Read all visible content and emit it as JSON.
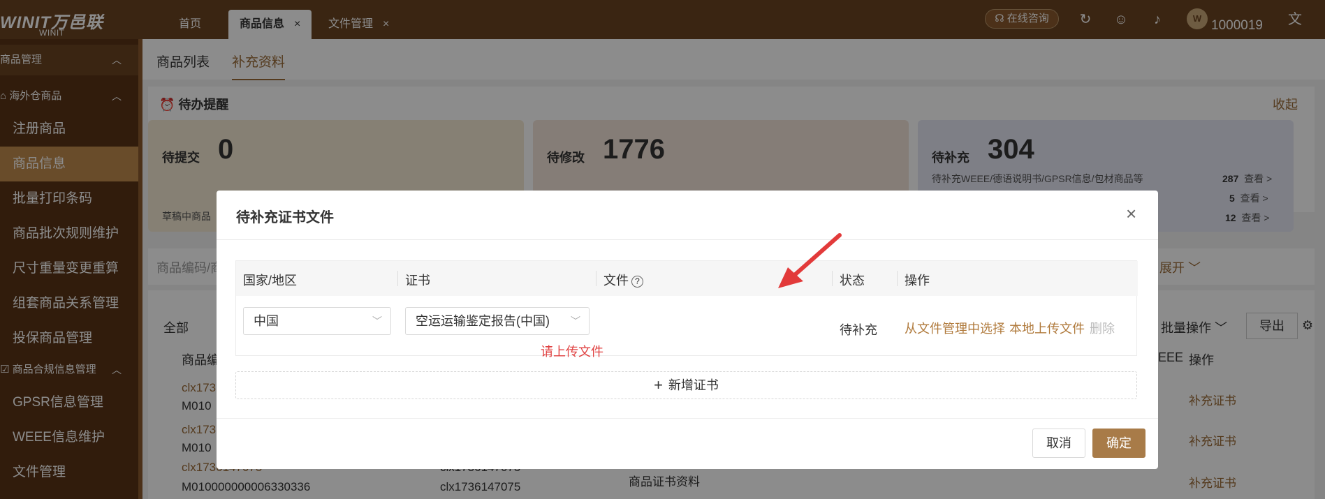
{
  "header": {
    "logo_brand": "WINIT万邑联",
    "logo_corp": "WINIT CORPORATION",
    "tabs": [
      {
        "label": "首页"
      },
      {
        "label": "商品信息"
      },
      {
        "label": "文件管理"
      }
    ],
    "close_glyph": "×",
    "consult_label": "在线咨询",
    "user_id": "1000019",
    "avatar_text": "W",
    "icons": [
      "refresh-icon",
      "service-icon",
      "bell-icon",
      "translate-icon"
    ]
  },
  "sidebar": {
    "group_label": "商品管理",
    "sub1_label": "海外仓商品",
    "items1": [
      "注册商品",
      "商品信息",
      "批量打印条码",
      "商品批次规则维护",
      "尺寸重量变更重算",
      "组套商品关系管理",
      "投保商品管理"
    ],
    "sub2_label": "商品合规信息管理",
    "items2": [
      "GPSR信息管理",
      "WEEE信息维护",
      "文件管理"
    ]
  },
  "content": {
    "subtabs": [
      "商品列表",
      "补充资料"
    ],
    "todo_title": "待办提醒",
    "collapse": "收起",
    "cards": [
      {
        "label": "待提交",
        "value": "0",
        "note": "草稿中商品"
      },
      {
        "label": "待修改",
        "value": "1776"
      },
      {
        "label": "待补充",
        "value": "304",
        "note": "待补充WEEE/德语说明书/GPSR信息/包材商品等"
      }
    ],
    "pending_rows": [
      {
        "count": "287",
        "link": "查看 >"
      },
      {
        "count": "5",
        "link": "查看 >"
      },
      {
        "count": "12",
        "link": "查看 >"
      }
    ],
    "search_placeholder": "商品编码/商",
    "expand": "展开",
    "all_tab": "全部",
    "batch_op": "批量操作",
    "export": "导出",
    "col_product": "商品编",
    "col_op": "操作",
    "col_weee": "EEE",
    "rows": [
      {
        "code1": "clx173",
        "code2": "M010",
        "action": "补充证书"
      },
      {
        "code1": "clx173",
        "code2": "M010",
        "action": "补充证书"
      },
      {
        "code1": "clx1736147075",
        "code2": "M010000000006330336",
        "code3": "clx1736147075",
        "code4": "clx1736147075",
        "desc": "商品证书资料",
        "action": "补充证书"
      }
    ]
  },
  "modal": {
    "title": "待补充证书文件",
    "close": "×",
    "columns": {
      "country": "国家/地区",
      "cert": "证书",
      "file": "文件",
      "status": "状态",
      "op": "操作"
    },
    "help_glyph": "?",
    "row": {
      "country": "中国",
      "cert": "空运运输鉴定报告(中国)",
      "upload_tip": "请上传文件",
      "status": "待补充",
      "action_select": "从文件管理中选择",
      "action_upload": "本地上传文件",
      "action_delete": "删除"
    },
    "add_cert": "新增证书",
    "cancel": "取消",
    "ok": "确定"
  },
  "colors": {
    "brand": "#6b4421",
    "accent": "#a87b48",
    "link": "#b07a3c",
    "error": "#e04040"
  }
}
